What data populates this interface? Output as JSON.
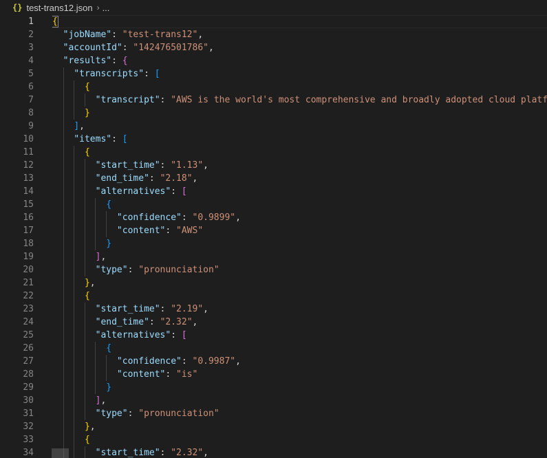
{
  "breadcrumb": {
    "icon": "{}",
    "file": "test-trans12.json",
    "separator": "›",
    "more": "..."
  },
  "colors": {
    "key": "#9cdcfe",
    "string": "#ce9178",
    "punct": "#d4d4d4",
    "bracket1": "#ffd700",
    "bracket2": "#da70d6",
    "bracket3": "#179fff",
    "background": "#1e1e1e",
    "line_number": "#858585"
  },
  "current_line": 1,
  "lines": [
    {
      "n": "1",
      "indent": 0,
      "t": [
        [
          "b1",
          "{"
        ]
      ]
    },
    {
      "n": "2",
      "indent": 1,
      "t": [
        [
          "k",
          "\"jobName\""
        ],
        [
          "p",
          ": "
        ],
        [
          "s",
          "\"test-trans12\""
        ],
        [
          "p",
          ","
        ]
      ]
    },
    {
      "n": "3",
      "indent": 1,
      "t": [
        [
          "k",
          "\"accountId\""
        ],
        [
          "p",
          ": "
        ],
        [
          "s",
          "\"142476501786\""
        ],
        [
          "p",
          ","
        ]
      ]
    },
    {
      "n": "4",
      "indent": 1,
      "t": [
        [
          "k",
          "\"results\""
        ],
        [
          "p",
          ": "
        ],
        [
          "b2",
          "{"
        ]
      ]
    },
    {
      "n": "5",
      "indent": 2,
      "t": [
        [
          "k",
          "\"transcripts\""
        ],
        [
          "p",
          ": "
        ],
        [
          "b3",
          "["
        ]
      ]
    },
    {
      "n": "6",
      "indent": 3,
      "t": [
        [
          "b1",
          "{"
        ]
      ]
    },
    {
      "n": "7",
      "indent": 4,
      "t": [
        [
          "k",
          "\"transcript\""
        ],
        [
          "p",
          ": "
        ],
        [
          "s",
          "\"AWS is the world's most comprehensive and broadly adopted cloud platfor"
        ]
      ]
    },
    {
      "n": "8",
      "indent": 3,
      "t": [
        [
          "b1",
          "}"
        ]
      ]
    },
    {
      "n": "9",
      "indent": 2,
      "t": [
        [
          "b3",
          "]"
        ],
        [
          "p",
          ","
        ]
      ]
    },
    {
      "n": "10",
      "indent": 2,
      "t": [
        [
          "k",
          "\"items\""
        ],
        [
          "p",
          ": "
        ],
        [
          "b3",
          "["
        ]
      ]
    },
    {
      "n": "11",
      "indent": 3,
      "t": [
        [
          "b1",
          "{"
        ]
      ]
    },
    {
      "n": "12",
      "indent": 4,
      "t": [
        [
          "k",
          "\"start_time\""
        ],
        [
          "p",
          ": "
        ],
        [
          "s",
          "\"1.13\""
        ],
        [
          "p",
          ","
        ]
      ]
    },
    {
      "n": "13",
      "indent": 4,
      "t": [
        [
          "k",
          "\"end_time\""
        ],
        [
          "p",
          ": "
        ],
        [
          "s",
          "\"2.18\""
        ],
        [
          "p",
          ","
        ]
      ]
    },
    {
      "n": "14",
      "indent": 4,
      "t": [
        [
          "k",
          "\"alternatives\""
        ],
        [
          "p",
          ": "
        ],
        [
          "b2",
          "["
        ]
      ]
    },
    {
      "n": "15",
      "indent": 5,
      "t": [
        [
          "b3",
          "{"
        ]
      ]
    },
    {
      "n": "16",
      "indent": 6,
      "t": [
        [
          "k",
          "\"confidence\""
        ],
        [
          "p",
          ": "
        ],
        [
          "s",
          "\"0.9899\""
        ],
        [
          "p",
          ","
        ]
      ]
    },
    {
      "n": "17",
      "indent": 6,
      "t": [
        [
          "k",
          "\"content\""
        ],
        [
          "p",
          ": "
        ],
        [
          "s",
          "\"AWS\""
        ]
      ]
    },
    {
      "n": "18",
      "indent": 5,
      "t": [
        [
          "b3",
          "}"
        ]
      ]
    },
    {
      "n": "19",
      "indent": 4,
      "t": [
        [
          "b2",
          "]"
        ],
        [
          "p",
          ","
        ]
      ]
    },
    {
      "n": "20",
      "indent": 4,
      "t": [
        [
          "k",
          "\"type\""
        ],
        [
          "p",
          ": "
        ],
        [
          "s",
          "\"pronunciation\""
        ]
      ]
    },
    {
      "n": "21",
      "indent": 3,
      "t": [
        [
          "b1",
          "}"
        ],
        [
          "p",
          ","
        ]
      ]
    },
    {
      "n": "22",
      "indent": 3,
      "t": [
        [
          "b1",
          "{"
        ]
      ]
    },
    {
      "n": "23",
      "indent": 4,
      "t": [
        [
          "k",
          "\"start_time\""
        ],
        [
          "p",
          ": "
        ],
        [
          "s",
          "\"2.19\""
        ],
        [
          "p",
          ","
        ]
      ]
    },
    {
      "n": "24",
      "indent": 4,
      "t": [
        [
          "k",
          "\"end_time\""
        ],
        [
          "p",
          ": "
        ],
        [
          "s",
          "\"2.32\""
        ],
        [
          "p",
          ","
        ]
      ]
    },
    {
      "n": "25",
      "indent": 4,
      "t": [
        [
          "k",
          "\"alternatives\""
        ],
        [
          "p",
          ": "
        ],
        [
          "b2",
          "["
        ]
      ]
    },
    {
      "n": "26",
      "indent": 5,
      "t": [
        [
          "b3",
          "{"
        ]
      ]
    },
    {
      "n": "27",
      "indent": 6,
      "t": [
        [
          "k",
          "\"confidence\""
        ],
        [
          "p",
          ": "
        ],
        [
          "s",
          "\"0.9987\""
        ],
        [
          "p",
          ","
        ]
      ]
    },
    {
      "n": "28",
      "indent": 6,
      "t": [
        [
          "k",
          "\"content\""
        ],
        [
          "p",
          ": "
        ],
        [
          "s",
          "\"is\""
        ]
      ]
    },
    {
      "n": "29",
      "indent": 5,
      "t": [
        [
          "b3",
          "}"
        ]
      ]
    },
    {
      "n": "30",
      "indent": 4,
      "t": [
        [
          "b2",
          "]"
        ],
        [
          "p",
          ","
        ]
      ]
    },
    {
      "n": "31",
      "indent": 4,
      "t": [
        [
          "k",
          "\"type\""
        ],
        [
          "p",
          ": "
        ],
        [
          "s",
          "\"pronunciation\""
        ]
      ]
    },
    {
      "n": "32",
      "indent": 3,
      "t": [
        [
          "b1",
          "}"
        ],
        [
          "p",
          ","
        ]
      ]
    },
    {
      "n": "33",
      "indent": 3,
      "t": [
        [
          "b1",
          "{"
        ]
      ]
    },
    {
      "n": "34",
      "indent": 4,
      "t": [
        [
          "k",
          "\"start_time\""
        ],
        [
          "p",
          ": "
        ],
        [
          "s",
          "\"2.32\""
        ],
        [
          "p",
          ","
        ]
      ]
    }
  ]
}
